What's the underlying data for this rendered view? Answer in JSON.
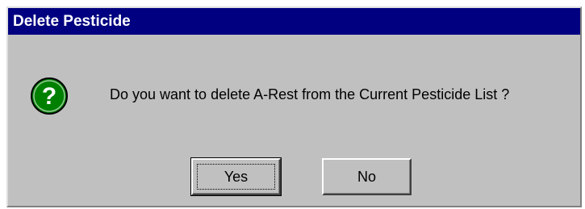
{
  "dialog": {
    "title": "Delete Pesticide",
    "message": "Do you want to delete A-Rest from the Current Pesticide List ?",
    "icon": "question-icon",
    "buttons": {
      "yes_label": "Yes",
      "no_label": "No"
    }
  },
  "colors": {
    "titlebar": "#000080",
    "face": "#c0c0c0",
    "icon_fill": "#008000"
  }
}
